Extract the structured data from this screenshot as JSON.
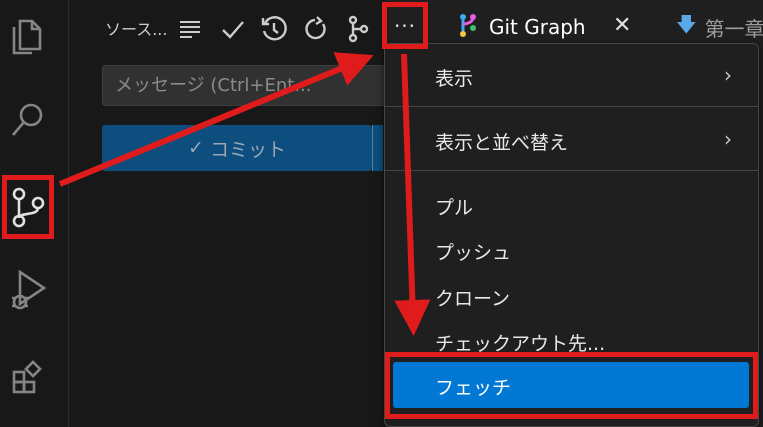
{
  "activity_bar": {
    "items": [
      {
        "name": "explorer",
        "icon": "files-icon"
      },
      {
        "name": "search",
        "icon": "search-icon"
      },
      {
        "name": "source-control",
        "icon": "source-control-icon"
      },
      {
        "name": "run-debug",
        "icon": "run-debug-icon"
      },
      {
        "name": "extensions",
        "icon": "extensions-icon"
      }
    ]
  },
  "source_control": {
    "title": "ソース...",
    "message_placeholder": "メッセージ (Ctrl+Ent...",
    "commit_label": "コミット",
    "commit_check": "✓",
    "more_label": "···"
  },
  "tabs": {
    "git_graph_label": "Git Graph",
    "git_graph_close": "✕",
    "doc_label": "第一章"
  },
  "menu": {
    "items": [
      {
        "label": "表示",
        "submenu": "›"
      },
      {
        "label": "表示と並べ替え",
        "submenu": "›"
      },
      {
        "label": "プル"
      },
      {
        "label": "プッシュ"
      },
      {
        "label": "クローン"
      },
      {
        "label": "チェックアウト先..."
      },
      {
        "label": "フェッチ"
      }
    ]
  },
  "colors": {
    "highlight": "#0078d4",
    "annotation_red": "#e01b1b",
    "commit_button": "#0e4e7e"
  }
}
